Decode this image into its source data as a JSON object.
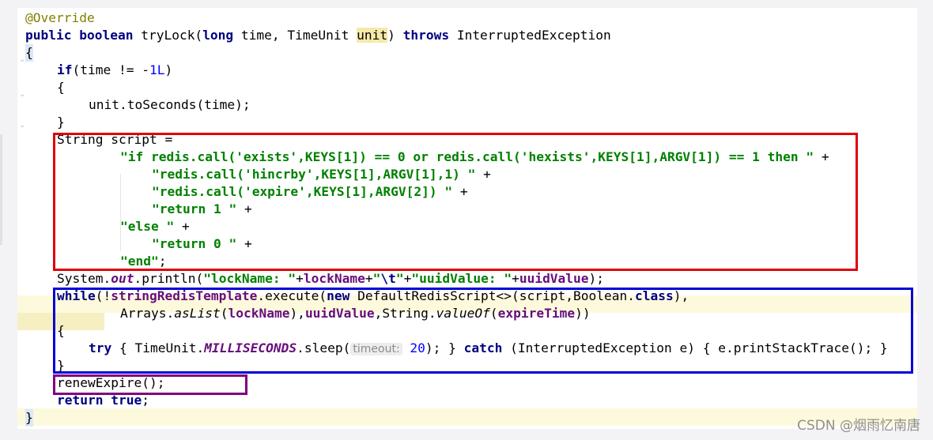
{
  "editor": {
    "line_1": "@Override",
    "line_2": {
      "kw1": "public",
      "kw2": "boolean",
      "name": " tryLock(",
      "kw3": "long",
      "mid": " time, TimeUnit ",
      "param": "unit",
      "close": ") ",
      "kw4": "throws",
      "tail": " InterruptedException"
    },
    "line_3": "{",
    "line_4": {
      "kw": "if",
      "a": "(time != -",
      "num": "1L",
      "b": ")"
    },
    "line_5": "{",
    "line_6": "unit.toSeconds(time);",
    "line_7": "}",
    "line_8": "String script =",
    "line_9": {
      "s": "\"if redis.call('exists',KEYS[1]) == 0 or redis.call('hexists',KEYS[1],ARGV[1]) == 1 then \"",
      "op": " +"
    },
    "line_10": {
      "s": "\"redis.call('hincrby',KEYS[1],ARGV[1],1) \"",
      "op": " +"
    },
    "line_11": {
      "s": "\"redis.call('expire',KEYS[1],ARGV[2]) \"",
      "op": " +"
    },
    "line_12": {
      "s": "\"return 1 \"",
      "op": " +"
    },
    "line_13": {
      "s": "\"else \"",
      "op": " +"
    },
    "line_14": {
      "s": "\"return 0 \"",
      "op": " +"
    },
    "line_15": {
      "s": "\"end\"",
      "op": ";"
    },
    "line_16": {
      "a": "System.",
      "out": "out",
      "b": ".println(",
      "s1": "\"lockName: \"",
      "p1": "+",
      "f1": "lockName",
      "p2": "+",
      "s2a": "\"",
      "esc": "\\t",
      "s2b": "\"",
      "p3": "+",
      "s3": "\"uuidValue: \"",
      "p4": "+",
      "f2": "uuidValue",
      "c": ");"
    },
    "line_17": {
      "kw": "while",
      "a": "(!",
      "f1": "stringRedisTemplate",
      "b": ".execute(",
      "kw2": "new",
      "c": " DefaultRedisScript<>(script,Boolean.",
      "kw3": "class",
      "d": "),"
    },
    "line_18": {
      "a": "Arrays.",
      "m": "asList",
      "b": "(",
      "f1": "lockName",
      "c": "),",
      "f2": "uuidValue",
      "d": ",String.",
      "m2": "valueOf",
      "e": "(",
      "f3": "expireTime",
      "g": "))"
    },
    "line_19": "{",
    "line_20": {
      "kw": "try",
      "a": " { TimeUnit.",
      "sf": "MILLISECONDS",
      "b": ".sleep(",
      "hint": "timeout:",
      "num": "20",
      "c": "); } ",
      "kw2": "catch",
      "d": " (InterruptedException e) { e.printStackTrace(); }"
    },
    "line_21": "}",
    "line_22": "renewExpire();",
    "line_23": {
      "kw": "return",
      "sp": " ",
      "kw2": "true",
      "semi": ";"
    },
    "line_24": "}"
  },
  "colors": {
    "red_box": "#e0000a",
    "blue_box": "#0000d8",
    "purple_box": "#800080",
    "current_line": "#fdf9dc"
  },
  "watermark": "CSDN @烟雨忆南唐"
}
